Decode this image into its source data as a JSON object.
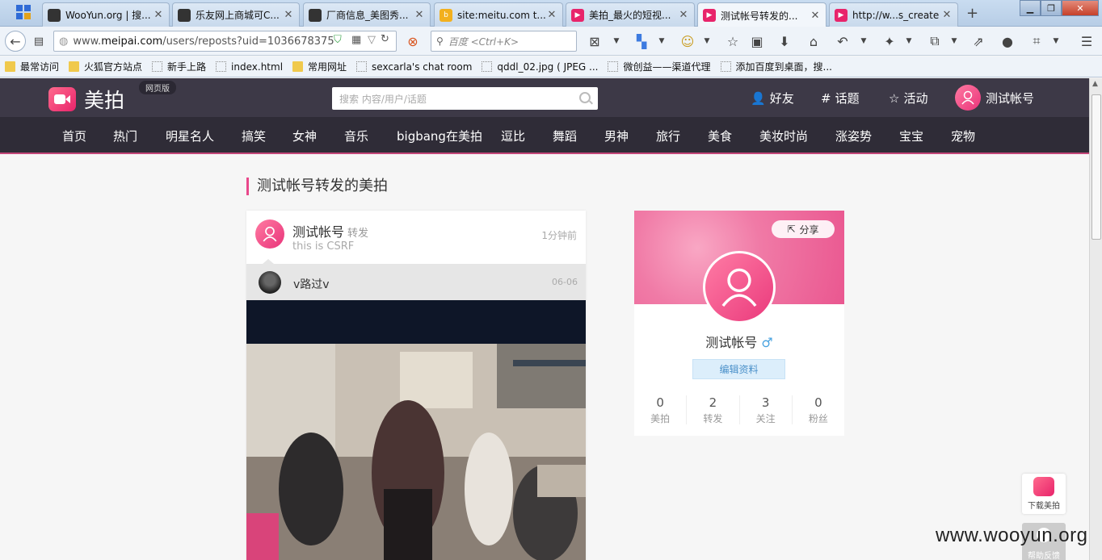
{
  "browser": {
    "tabs": [
      {
        "title": "WooYun.org | 搜...",
        "color": "#333333"
      },
      {
        "title": "乐友网上商城可C...",
        "color": "#333333"
      },
      {
        "title": "厂商信息_美图秀...",
        "color": "#333333"
      },
      {
        "title": "site:meitu.com t...",
        "color": "#f2b01e"
      },
      {
        "title": "美拍_最火的短视...",
        "color": "#e8246b"
      },
      {
        "title": "测试帐号转发的...",
        "color": "#e8246b"
      },
      {
        "title": "http://w...s_create",
        "color": "#e8246b"
      }
    ],
    "url_prefix": "www.",
    "url_domain": "meipai.com",
    "url_path": "/users/reposts?uid=1036678375",
    "search_placeholder": "百度 <Ctrl+K>",
    "bookmarks": [
      {
        "label": "最常访问",
        "kind": "folder"
      },
      {
        "label": "火狐官方站点",
        "kind": "folder"
      },
      {
        "label": "新手上路",
        "kind": "page"
      },
      {
        "label": "index.html",
        "kind": "page"
      },
      {
        "label": "常用网址",
        "kind": "folder"
      },
      {
        "label": "sexcarla's chat room",
        "kind": "page"
      },
      {
        "label": "qddl_02.jpg ( JPEG ...",
        "kind": "page"
      },
      {
        "label": "微创益——渠道代理",
        "kind": "page"
      },
      {
        "label": "添加百度到桌面，搜...",
        "kind": "page"
      }
    ]
  },
  "site": {
    "logo_text": "美拍",
    "web_version_badge": "网页版",
    "search_placeholder": "搜索 内容/用户/话题",
    "top_links": {
      "friends": "好友",
      "topics": "话题",
      "activities": "活动",
      "user": "测试帐号"
    },
    "nav": [
      "首页",
      "热门",
      "明星名人",
      "搞笑",
      "女神",
      "音乐",
      "bigbang在美拍",
      "逗比",
      "舞蹈",
      "男神",
      "旅行",
      "美食",
      "美妆时尚",
      "涨姿势",
      "宝宝",
      "宠物"
    ]
  },
  "section_title": "测试帐号转发的美拍",
  "post": {
    "user": "测试帐号",
    "action": "转发",
    "caption": "this is CSRF",
    "time": "1分钟前",
    "original_user": "v路过v",
    "original_date": "06-06"
  },
  "profile": {
    "share_label": "分享",
    "name": "测试帐号",
    "gender_symbol": "♂",
    "edit_label": "编辑资料",
    "stats": [
      {
        "value": "0",
        "label": "美拍"
      },
      {
        "value": "2",
        "label": "转发"
      },
      {
        "value": "3",
        "label": "关注"
      },
      {
        "value": "0",
        "label": "粉丝"
      }
    ]
  },
  "floating": {
    "download_label": "下载美拍",
    "feedback_label": "帮助反馈"
  },
  "watermark": "www.wooyun.org"
}
